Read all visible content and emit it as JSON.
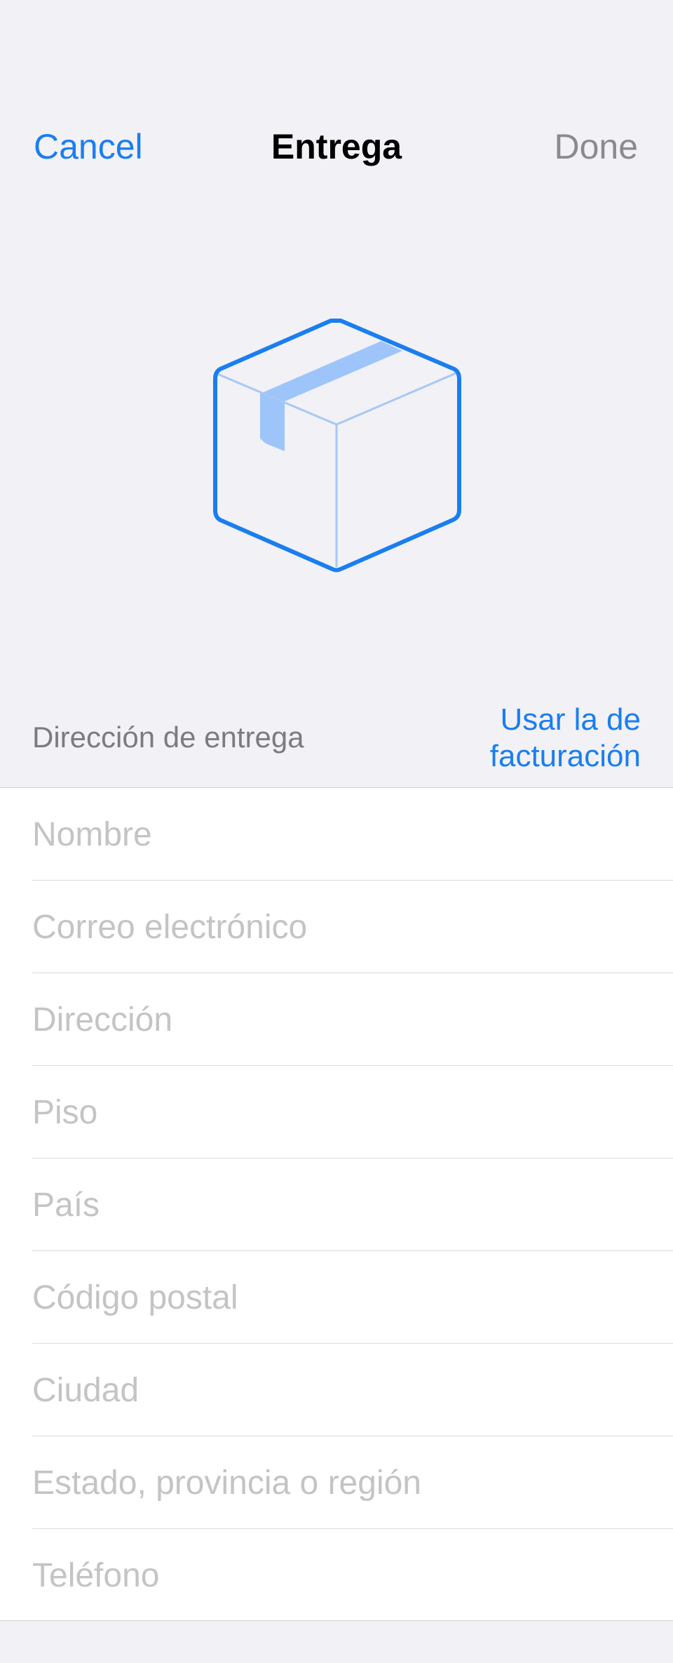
{
  "nav": {
    "cancel_label": "Cancel",
    "title": "Entrega",
    "done_label": "Done"
  },
  "section": {
    "label": "Dirección de entrega",
    "use_billing_label": "Usar la de facturación"
  },
  "form": {
    "fields": [
      {
        "placeholder": "Nombre",
        "value": ""
      },
      {
        "placeholder": "Correo electrónico",
        "value": ""
      },
      {
        "placeholder": "Dirección",
        "value": ""
      },
      {
        "placeholder": "Piso",
        "value": ""
      },
      {
        "placeholder": "País",
        "value": ""
      },
      {
        "placeholder": "Código postal",
        "value": ""
      },
      {
        "placeholder": "Ciudad",
        "value": ""
      },
      {
        "placeholder": "Estado, provincia o región",
        "value": ""
      },
      {
        "placeholder": "Teléfono",
        "value": ""
      }
    ]
  },
  "colors": {
    "accent": "#1a7ef0",
    "background": "#f2f1f6",
    "disabled_text": "#8a8a8f",
    "placeholder": "#c4c4c7",
    "box_tape": "#9ec5fa"
  },
  "icons": {
    "illustration": "package-box-icon"
  }
}
